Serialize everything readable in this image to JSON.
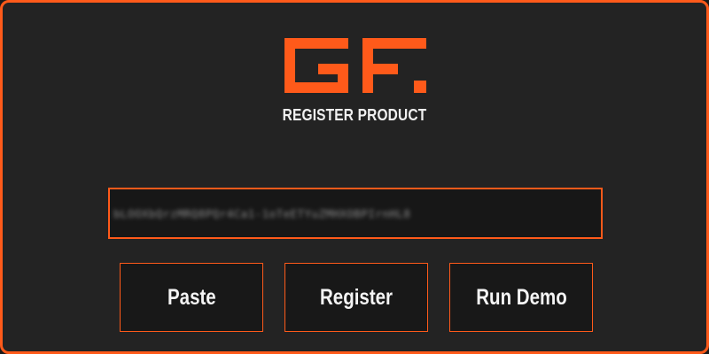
{
  "app": {
    "title": "REGISTER PRODUCT",
    "logo_text": "GF.",
    "accent_color": "#ff5a1a",
    "background_color": "#232323"
  },
  "license": {
    "key_value": "bLOOXbQrzMRQ8PQr4Ca1-1oTeETYuZMHXOBPIrnHL8"
  },
  "actions": {
    "paste_label": "Paste",
    "register_label": "Register",
    "demo_label": "Run Demo"
  }
}
